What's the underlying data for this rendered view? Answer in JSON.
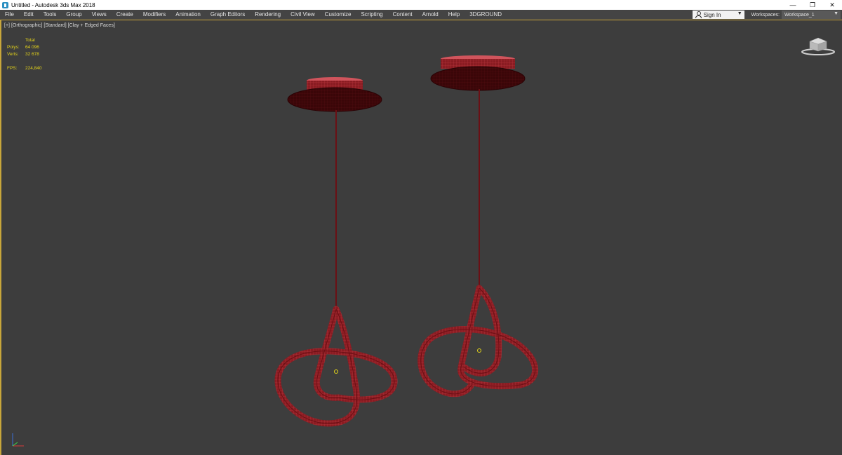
{
  "window": {
    "title": "Untitled - Autodesk 3ds Max 2018",
    "controls": {
      "minimize": "—",
      "restore": "❐",
      "close": "✕"
    }
  },
  "menu": {
    "items": [
      "File",
      "Edit",
      "Tools",
      "Group",
      "Views",
      "Create",
      "Modifiers",
      "Animation",
      "Graph Editors",
      "Rendering",
      "Civil View",
      "Customize",
      "Scripting",
      "Content",
      "Arnold",
      "Help",
      "3DGROUND"
    ],
    "sign_in": "Sign In",
    "workspaces_label": "Workspaces:",
    "workspace_value": "Workspace_1"
  },
  "viewport": {
    "labels": [
      "[+]",
      "[Orthographic]",
      "[Standard]",
      "[Clay + Edged Faces]"
    ],
    "stats": {
      "header": "Total",
      "polys_label": "Polys:",
      "polys_value": "64 096",
      "verts_label": "Verts:",
      "verts_value": "32 678",
      "fps_label": "FPS:",
      "fps_value": "224,840"
    }
  },
  "colors": {
    "viewport_bg": "#3d3d3d",
    "accent": "#c8a63b",
    "mesh": "#8a1c22",
    "mesh_edge": "#c23a42",
    "stats_text": "#e3d21a"
  },
  "icons": {
    "app": "3ds-max-icon",
    "user": "user-icon",
    "viewcube": "viewcube-icon",
    "axis": "axis-gizmo-icon"
  }
}
